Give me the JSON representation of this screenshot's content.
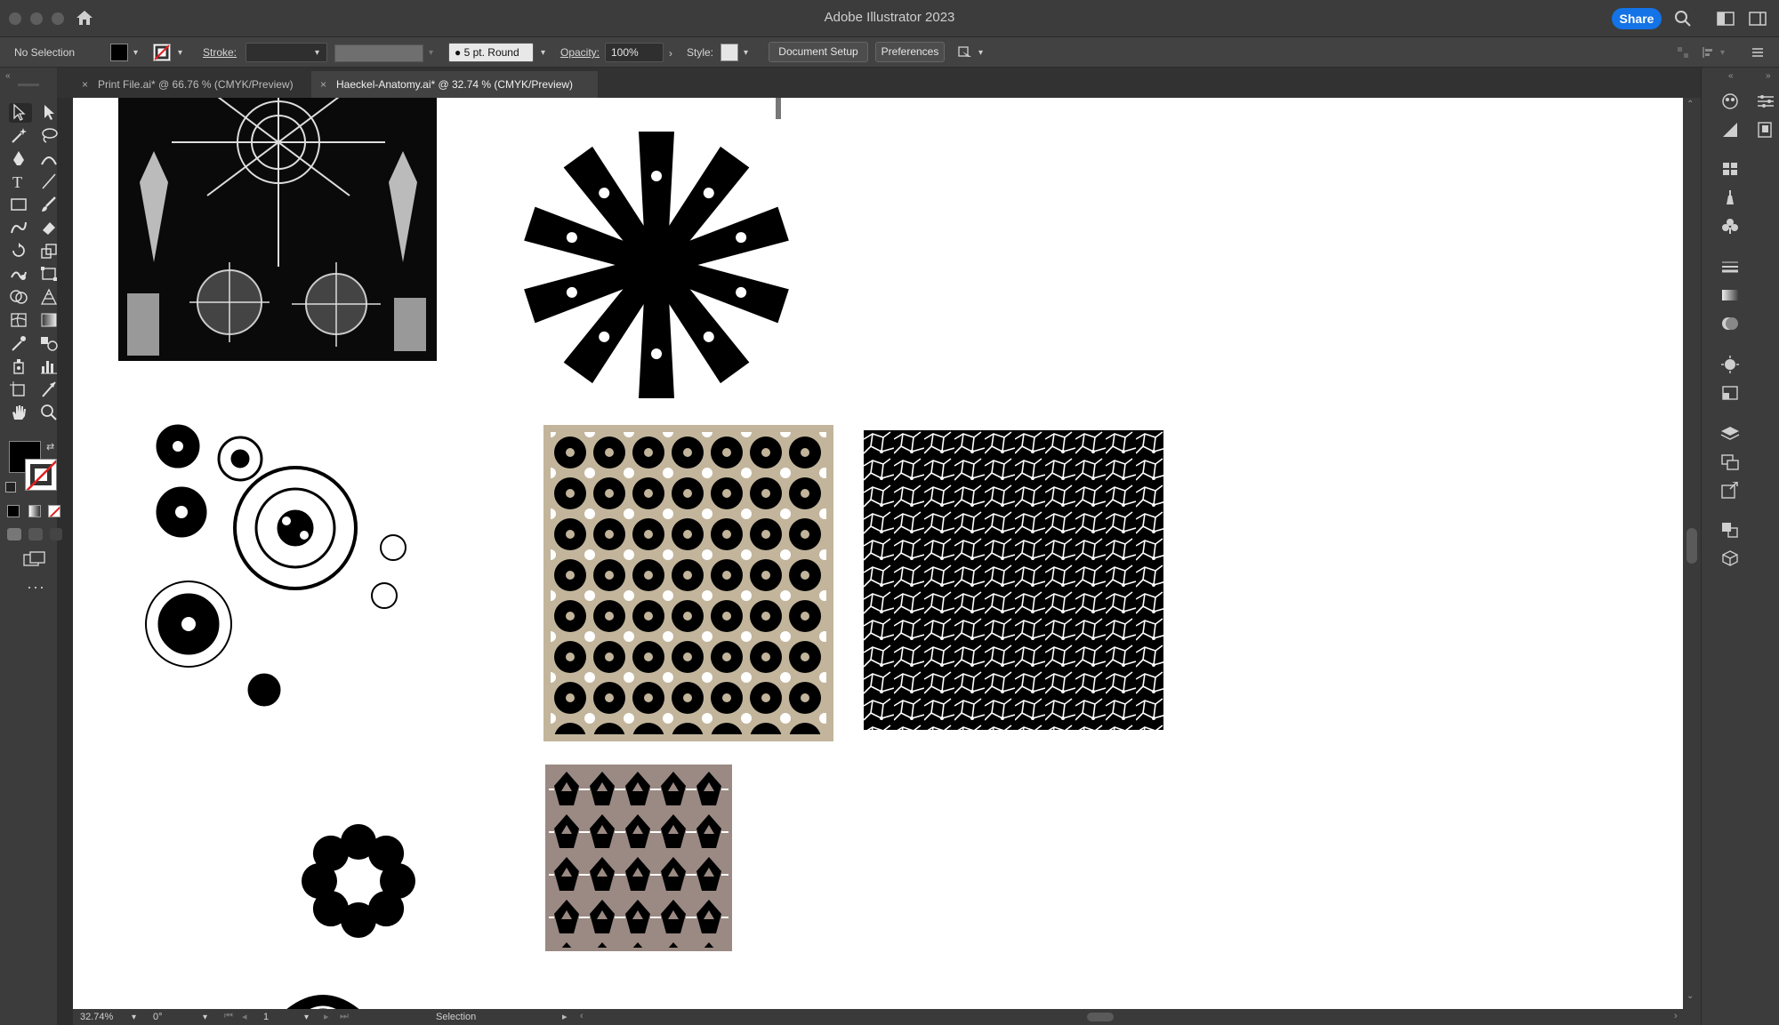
{
  "app": {
    "title": "Adobe Illustrator 2023",
    "share_label": "Share"
  },
  "controlbar": {
    "selection_status": "No Selection",
    "stroke_label": "Stroke:",
    "brush_value": "5 pt. Round",
    "opacity_label": "Opacity:",
    "opacity_value": "100%",
    "style_label": "Style:",
    "document_setup_label": "Document Setup",
    "preferences_label": "Preferences"
  },
  "tabs": [
    {
      "label": "Print File.ai* @ 66.76 % (CMYK/Preview)",
      "active": false
    },
    {
      "label": "Haeckel-Anatomy.ai* @ 32.74 % (CMYK/Preview)",
      "active": true
    }
  ],
  "statusbar": {
    "zoom": "32.74%",
    "rotation": "0°",
    "artboard": "1",
    "tool": "Selection"
  },
  "colors": {
    "fill": "#000000",
    "pattern_tan": "#c2b59b",
    "pattern_mauve": "#9a8a83",
    "accent": "#1473e6"
  }
}
